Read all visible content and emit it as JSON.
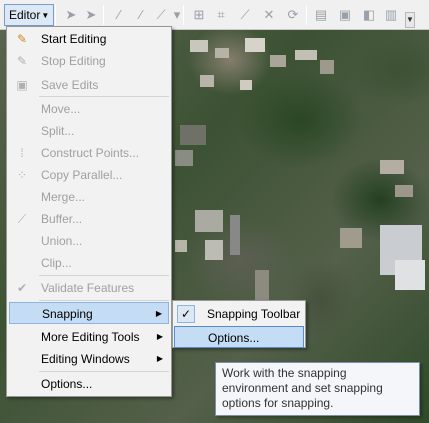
{
  "toolbar": {
    "editor_label": "Editor",
    "icons": [
      "edit-tool-icon",
      "edit-annotation-icon",
      "straight-segment-icon",
      "endpoint-arc-icon",
      "trace-icon",
      "construction-tools-icon",
      "edit-vertices-icon",
      "reshape-icon",
      "cut-polygons-icon",
      "split-icon",
      "rotate-icon",
      "attributes-icon",
      "sketch-properties-icon",
      "create-features-icon"
    ]
  },
  "menu": {
    "items": [
      {
        "label": "Start Editing",
        "icon": "pencil-icon",
        "enabled": true
      },
      {
        "label": "Stop Editing",
        "icon": "stop-pencil-icon",
        "enabled": false
      },
      {
        "label": "Save Edits",
        "icon": "save-icon",
        "enabled": false
      },
      {
        "label": "Move...",
        "enabled": false
      },
      {
        "label": "Split...",
        "enabled": false
      },
      {
        "label": "Construct Points...",
        "icon": "construct-points-icon",
        "enabled": false
      },
      {
        "label": "Copy Parallel...",
        "icon": "copy-parallel-icon",
        "enabled": false
      },
      {
        "label": "Merge...",
        "enabled": false
      },
      {
        "label": "Buffer...",
        "icon": "buffer-icon",
        "enabled": false
      },
      {
        "label": "Union...",
        "enabled": false
      },
      {
        "label": "Clip...",
        "enabled": false
      },
      {
        "label": "Validate Features",
        "icon": "validate-icon",
        "enabled": false
      },
      {
        "label": "Snapping",
        "enabled": true,
        "submenu": true
      },
      {
        "label": "More Editing Tools",
        "enabled": true,
        "submenu": true
      },
      {
        "label": "Editing Windows",
        "enabled": true,
        "submenu": true
      },
      {
        "label": "Options...",
        "enabled": true
      }
    ]
  },
  "submenu": {
    "items": [
      {
        "label": "Snapping Toolbar",
        "checked": true
      },
      {
        "label": "Options...",
        "checked": false
      }
    ]
  },
  "tooltip": {
    "text": "Work with the snapping environment and set snapping options for snapping."
  },
  "colors": {
    "menu_bg": "#f2f2f2",
    "highlight": "#c5dcf5",
    "highlight_border": "#8fb4de",
    "disabled_text": "#a0a0a0"
  }
}
